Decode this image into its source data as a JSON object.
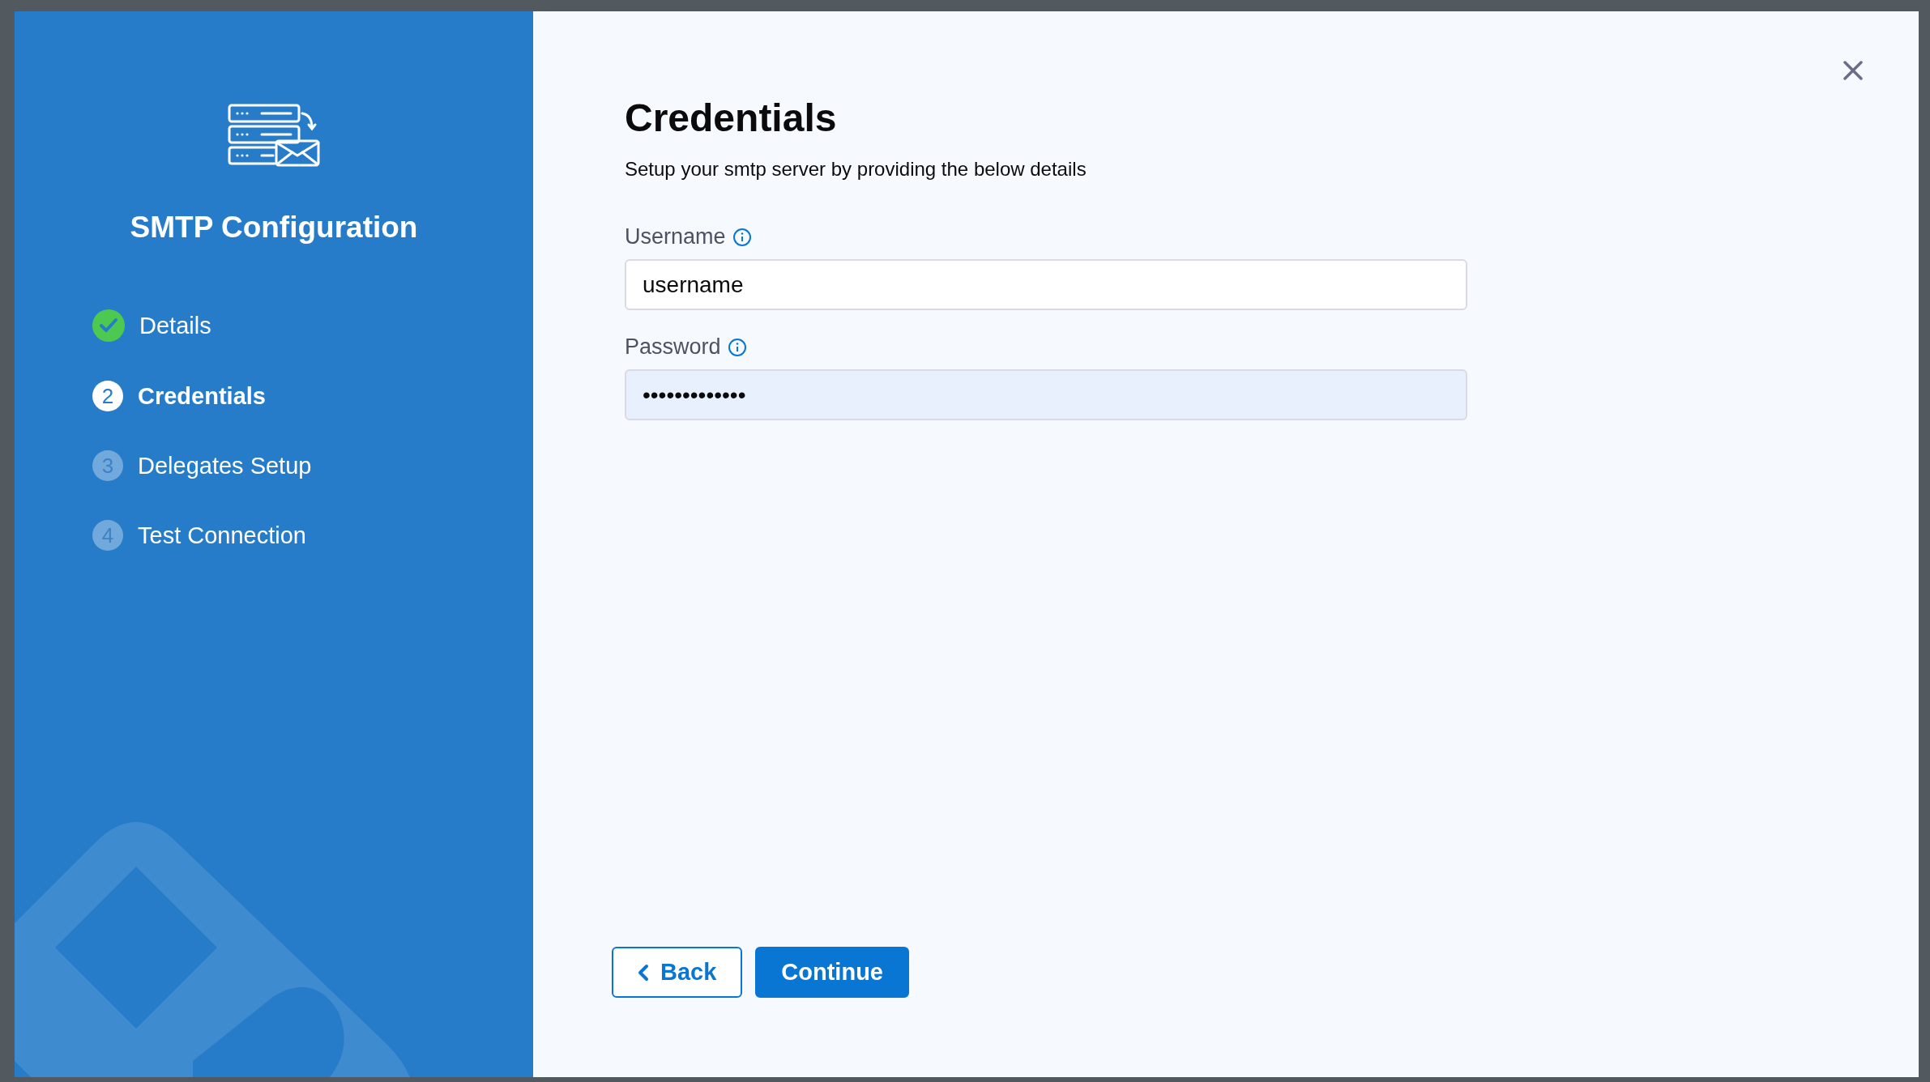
{
  "sidebar": {
    "title": "SMTP Configuration",
    "steps": [
      {
        "label": "Details",
        "kind": "done",
        "selected": false
      },
      {
        "number": "2",
        "label": "Credentials",
        "kind": "current",
        "selected": true
      },
      {
        "number": "3",
        "label": "Delegates Setup",
        "kind": "upcoming",
        "selected": false
      },
      {
        "number": "4",
        "label": "Test Connection",
        "kind": "upcoming",
        "selected": false
      }
    ]
  },
  "form": {
    "title": "Credentials",
    "subtitle": "Setup your smtp server by providing the below details",
    "fields": [
      {
        "label": "Username",
        "value": "username",
        "autofilled": false
      },
      {
        "label": "Password",
        "value": "•••••••••••••",
        "autofilled": true
      }
    ]
  },
  "buttons": [
    {
      "label": "Back",
      "kind": "secondary"
    },
    {
      "label": "Continue",
      "kind": "primary"
    }
  ]
}
